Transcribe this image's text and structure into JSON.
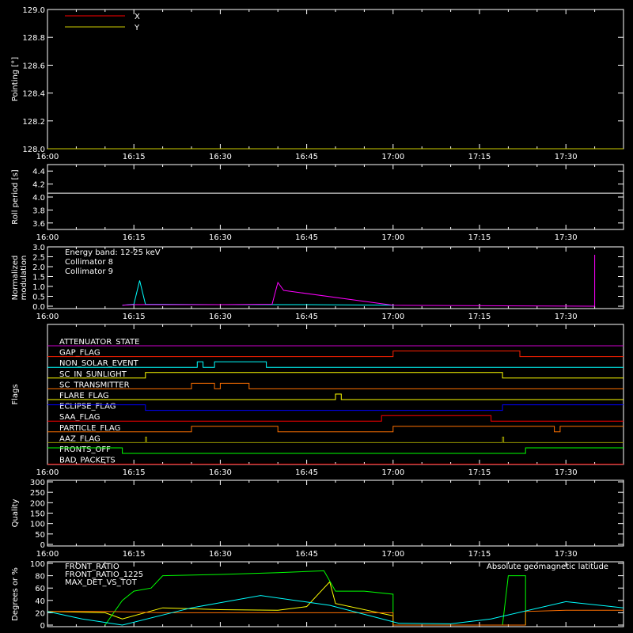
{
  "time_ticks": [
    "16:00",
    "16:15",
    "16:30",
    "16:45",
    "17:00",
    "17:15",
    "17:30"
  ],
  "panels": {
    "pointing": {
      "ylabel": "Pointing [°]",
      "yticks": [
        "128.0",
        "128.2",
        "128.4",
        "128.6",
        "128.8",
        "129.0"
      ],
      "legend": [
        {
          "label": "X",
          "color": "#ff0000"
        },
        {
          "label": "Y",
          "color": "#cccc00"
        }
      ]
    },
    "roll": {
      "ylabel": "Roll period [s]",
      "yticks": [
        "3.6",
        "3.8",
        "4.0",
        "4.2",
        "4.4"
      ]
    },
    "modulation": {
      "ylabel_line1": "Normalized",
      "ylabel_line2": "modulation",
      "yticks": [
        "0.0",
        "0.5",
        "1.0",
        "1.5",
        "2.0",
        "2.5",
        "3.0"
      ],
      "legend": [
        {
          "label": "Energy band: 12-25 keV",
          "color": "#ffffff"
        },
        {
          "label": "Collimator 8",
          "color": "#00ffff"
        },
        {
          "label": "Collimator 9",
          "color": "#ff00ff"
        }
      ]
    },
    "flags": {
      "ylabel": "Flags",
      "items": [
        {
          "label": "ATTENUATOR_STATE",
          "color": "#cc00cc"
        },
        {
          "label": "GAP_FLAG",
          "color": "#ff2000"
        },
        {
          "label": "NON_SOLAR_EVENT",
          "color": "#00ffff"
        },
        {
          "label": "SC_IN_SUNLIGHT",
          "color": "#ffff00"
        },
        {
          "label": "SC_TRANSMITTER",
          "color": "#ff7000"
        },
        {
          "label": "FLARE_FLAG",
          "color": "#ffff00"
        },
        {
          "label": "ECLIPSE_FLAG",
          "color": "#0000ff"
        },
        {
          "label": "SAA_FLAG",
          "color": "#ff0000"
        },
        {
          "label": "PARTICLE_FLAG",
          "color": "#ff7000"
        },
        {
          "label": "AAZ_FLAG",
          "color": "#999900"
        },
        {
          "label": "FRONTS_OFF",
          "color": "#00ff00"
        },
        {
          "label": "BAD_PACKETS",
          "color": "#ff0000"
        }
      ]
    },
    "quality": {
      "ylabel": "Quality",
      "yticks": [
        "0",
        "50",
        "100",
        "150",
        "200",
        "250",
        "300"
      ]
    },
    "ratio": {
      "ylabel": "Degrees or %",
      "yticks": [
        "0",
        "20",
        "40",
        "60",
        "80",
        "100"
      ],
      "legend": [
        {
          "label": "FRONT_RATIO",
          "color": "#ffff00"
        },
        {
          "label": "FRONT_RATIO_1225",
          "color": "#00ff00"
        },
        {
          "label": "MAX_DET_VS_TOT",
          "color": "#ff7000"
        }
      ],
      "legend_right": {
        "label": "Absolute geomagnetic latitude",
        "color": "#00ffff"
      }
    }
  },
  "chart_data": [
    {
      "type": "line",
      "ylabel": "Pointing [°]",
      "x_range": [
        "16:00",
        "17:40"
      ],
      "ylim": [
        128.0,
        129.0
      ],
      "series": [
        {
          "name": "X",
          "color": "#ff0000",
          "x": [
            "16:00",
            "17:40"
          ],
          "values": [
            128.0,
            128.0
          ]
        },
        {
          "name": "Y",
          "color": "#cccc00",
          "x": [
            "16:00",
            "17:40"
          ],
          "values": [
            128.0,
            128.0
          ]
        }
      ]
    },
    {
      "type": "line",
      "ylabel": "Roll period [s]",
      "x_range": [
        "16:00",
        "17:40"
      ],
      "ylim": [
        3.5,
        4.5
      ],
      "series": [
        {
          "color": "#ffffff",
          "x": [
            "16:00",
            "16:30",
            "17:00",
            "17:30",
            "17:40"
          ],
          "values": [
            4.06,
            4.06,
            4.06,
            4.06,
            4.06
          ]
        }
      ]
    },
    {
      "type": "line",
      "ylabel": "Normalized modulation",
      "x_range": [
        "16:00",
        "17:40"
      ],
      "ylim": [
        -0.1,
        3.0
      ],
      "series": [
        {
          "name": "Collimator 8",
          "color": "#00ffff",
          "x": [
            "16:13",
            "16:15",
            "16:16",
            "16:17",
            "16:30",
            "16:45",
            "17:00",
            "17:00"
          ],
          "values": [
            0.05,
            0.1,
            1.3,
            0.1,
            0.08,
            0.08,
            0.05,
            0.0
          ]
        },
        {
          "name": "Collimator 9",
          "color": "#ff00ff",
          "x": [
            "16:13",
            "16:15",
            "16:30",
            "16:39",
            "16:40",
            "16:41",
            "17:00",
            "17:35",
            "17:35",
            "17:35"
          ],
          "values": [
            0.05,
            0.08,
            0.08,
            0.1,
            1.2,
            0.8,
            0.05,
            0.0,
            2.6,
            0.0
          ]
        }
      ]
    },
    {
      "type": "table",
      "ylabel": "Flags",
      "x_range": [
        "16:00",
        "17:40"
      ],
      "flags": [
        {
          "name": "ATTENUATOR_STATE",
          "high": []
        },
        {
          "name": "GAP_FLAG",
          "high": [
            [
              "17:00",
              "17:22"
            ]
          ]
        },
        {
          "name": "NON_SOLAR_EVENT",
          "high": [
            [
              "16:26",
              "16:27"
            ],
            [
              "16:29",
              "16:38"
            ]
          ]
        },
        {
          "name": "SC_IN_SUNLIGHT",
          "high": [
            [
              "16:17",
              "17:19"
            ]
          ]
        },
        {
          "name": "SC_TRANSMITTER",
          "high": [
            [
              "16:25",
              "16:29"
            ],
            [
              "16:30",
              "16:35"
            ]
          ]
        },
        {
          "name": "FLARE_FLAG",
          "high": [
            [
              "16:50",
              "16:51"
            ]
          ]
        },
        {
          "name": "ECLIPSE_FLAG",
          "high": [
            [
              "16:00",
              "16:17"
            ],
            [
              "17:19",
              "17:40"
            ]
          ]
        },
        {
          "name": "SAA_FLAG",
          "high": [
            [
              "16:58",
              "17:17"
            ]
          ]
        },
        {
          "name": "PARTICLE_FLAG",
          "high": [
            [
              "16:25",
              "16:40"
            ],
            [
              "17:00",
              "17:28"
            ],
            [
              "17:29",
              "17:40"
            ]
          ]
        },
        {
          "name": "AAZ_FLAG",
          "high": [
            [
              "16:17",
              "16:17"
            ],
            [
              "17:19",
              "17:19"
            ]
          ]
        },
        {
          "name": "FRONTS_OFF",
          "high": [
            [
              "16:00",
              "16:13"
            ],
            [
              "17:23",
              "17:40"
            ]
          ]
        },
        {
          "name": "BAD_PACKETS",
          "high": []
        }
      ]
    },
    {
      "type": "line",
      "ylabel": "Quality",
      "x_range": [
        "16:00",
        "17:40"
      ],
      "ylim": [
        0,
        300
      ],
      "series": []
    },
    {
      "type": "line",
      "ylabel": "Degrees or %",
      "x_range": [
        "16:00",
        "17:40"
      ],
      "ylim": [
        0,
        100
      ],
      "series": [
        {
          "name": "FRONT_RATIO",
          "color": "#ffff00",
          "x": [
            "16:00",
            "16:10",
            "16:13",
            "16:20",
            "16:30",
            "16:40",
            "16:45",
            "16:48",
            "16:49",
            "16:50",
            "17:00",
            "17:00"
          ],
          "values": [
            22,
            20,
            10,
            28,
            25,
            24,
            30,
            60,
            70,
            35,
            15,
            0
          ]
        },
        {
          "name": "FRONT_RATIO_1225",
          "color": "#00ff00",
          "x": [
            "16:10",
            "16:13",
            "16:15",
            "16:18",
            "16:20",
            "16:30",
            "16:40",
            "16:48",
            "16:50",
            "16:55",
            "17:00",
            "17:00",
            "17:19",
            "17:20",
            "17:23",
            "17:23"
          ],
          "values": [
            0,
            40,
            55,
            60,
            80,
            82,
            85,
            88,
            55,
            55,
            50,
            0,
            0,
            80,
            80,
            0
          ]
        },
        {
          "name": "MAX_DET_VS_TOT",
          "color": "#ff7000",
          "x": [
            "16:00",
            "16:10",
            "16:20",
            "16:30",
            "16:40",
            "16:50",
            "17:00",
            "17:00",
            "17:23",
            "17:23",
            "17:30",
            "17:40"
          ],
          "values": [
            22,
            22,
            20,
            20,
            20,
            20,
            20,
            0,
            0,
            22,
            24,
            24
          ]
        },
        {
          "name": "Absolute geomagnetic latitude",
          "color": "#00ffff",
          "x": [
            "16:00",
            "16:06",
            "16:13",
            "16:25",
            "16:37",
            "16:49",
            "17:01",
            "17:10",
            "17:17",
            "17:30",
            "17:40"
          ],
          "values": [
            22,
            10,
            0,
            28,
            48,
            32,
            3,
            2,
            10,
            38,
            28
          ]
        }
      ]
    }
  ]
}
